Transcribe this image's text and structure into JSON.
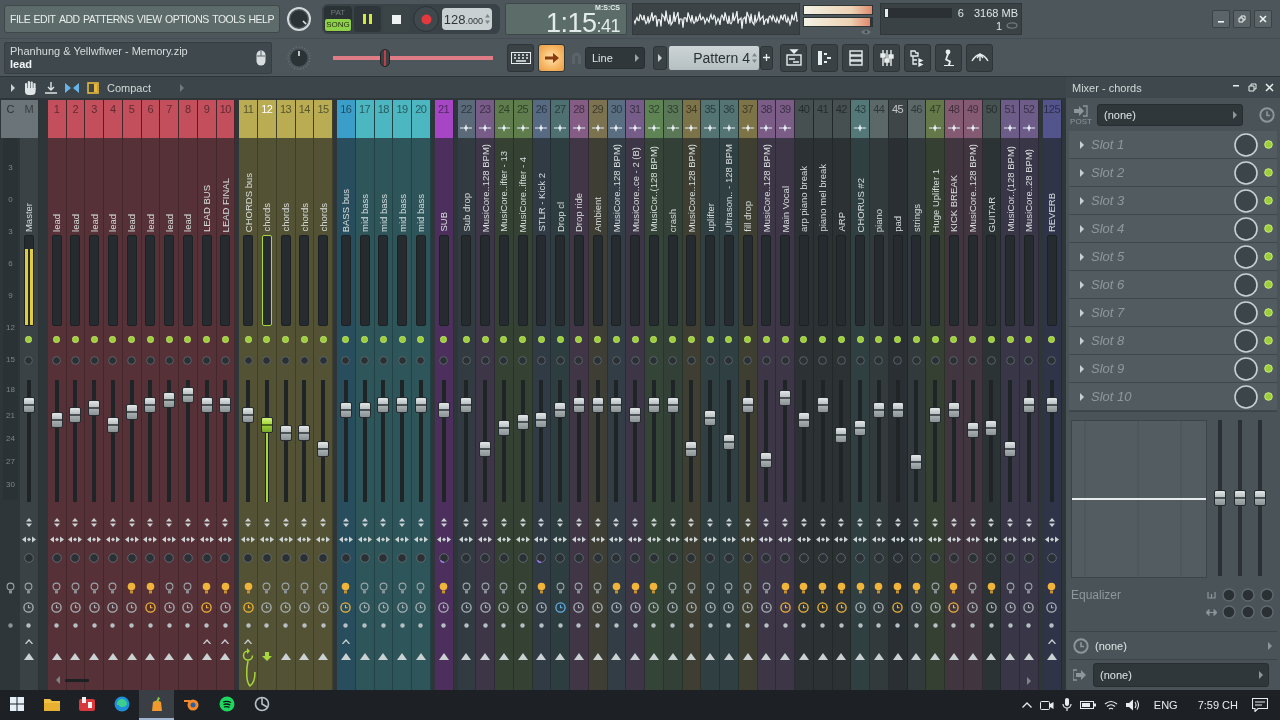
{
  "toolbar": {
    "menu": [
      "FILE",
      "EDIT",
      "ADD",
      "PATTERNS",
      "VIEW",
      "OPTIONS",
      "TOOLS",
      "HELP"
    ],
    "modes": [
      {
        "label": "PAT",
        "selected": false
      },
      {
        "label": "SONG",
        "selected": true
      }
    ],
    "playing": true,
    "tempo": "128",
    "tempo_fraction": ".000",
    "time": "1:15",
    "time_fraction": ":41",
    "time_format": "M:S:CS",
    "output_meter": [
      {
        "level": 1
      },
      {
        "level": 0.97
      }
    ],
    "cpu": {
      "level": 0.04
    },
    "voices": "6",
    "memory": "3168 MB",
    "counter": "1",
    "hint_title": "Phanhung & Yellwflwer - Memory.zip",
    "hint_text": "lead",
    "pitch": {
      "level": 0.31
    },
    "arrow_button": {
      "on": true
    },
    "snap": "Line",
    "pattern": "Pattern 4"
  },
  "mixer_bar": {
    "view": "Compact"
  },
  "mixer": {
    "current_label": "C",
    "scale": [
      "3",
      "0",
      "3",
      "6",
      "9",
      "12",
      "15",
      "18",
      "21",
      "24",
      "27",
      "30"
    ],
    "master": {
      "number": "M",
      "name": "Master",
      "active": true,
      "level": 0.84,
      "meter": {
        "level": 0.85
      },
      "bulb_lit": false,
      "clock_on": false,
      "send_caret": true
    },
    "groups": [
      {
        "strips": [
          {
            "number": "1",
            "name": "lead",
            "color": "#c44f5c",
            "selected": false,
            "active": true,
            "level": 0.7,
            "header_icon": false,
            "stereo_arc": false,
            "bulb_lit": false,
            "clock_on": false,
            "clock_focused": false,
            "send_caret": false,
            "route_target": false
          },
          {
            "number": "2",
            "name": "lead",
            "color": "#c44f5c",
            "selected": false,
            "active": true,
            "level": 0.75,
            "header_icon": false,
            "stereo_arc": false,
            "bulb_lit": false,
            "clock_on": false,
            "clock_focused": false,
            "send_caret": false,
            "route_target": false
          },
          {
            "number": "3",
            "name": "lead",
            "color": "#c44f5c",
            "selected": false,
            "active": true,
            "level": 0.81,
            "header_icon": false,
            "stereo_arc": false,
            "bulb_lit": false,
            "clock_on": false,
            "clock_focused": false,
            "send_caret": false,
            "route_target": false
          },
          {
            "number": "4",
            "name": "lead",
            "color": "#c44f5c",
            "selected": false,
            "active": true,
            "level": 0.65,
            "header_icon": false,
            "stereo_arc": false,
            "bulb_lit": false,
            "clock_on": false,
            "clock_focused": false,
            "send_caret": false,
            "route_target": false
          },
          {
            "number": "5",
            "name": "lead",
            "color": "#c44f5c",
            "selected": false,
            "active": true,
            "level": 0.77,
            "header_icon": false,
            "stereo_arc": false,
            "bulb_lit": true,
            "clock_on": false,
            "clock_focused": false,
            "send_caret": false,
            "route_target": false
          },
          {
            "number": "6",
            "name": "lead",
            "color": "#c44f5c",
            "selected": false,
            "active": true,
            "level": 0.84,
            "header_icon": false,
            "stereo_arc": false,
            "bulb_lit": true,
            "clock_on": true,
            "clock_focused": false,
            "send_caret": false,
            "route_target": false
          },
          {
            "number": "7",
            "name": "lead",
            "color": "#c44f5c",
            "selected": false,
            "active": true,
            "level": 0.89,
            "header_icon": false,
            "stereo_arc": false,
            "bulb_lit": false,
            "clock_on": false,
            "clock_focused": false,
            "send_caret": false,
            "route_target": false
          },
          {
            "number": "8",
            "name": "lead",
            "color": "#c44f5c",
            "selected": false,
            "active": true,
            "level": 0.93,
            "header_icon": false,
            "stereo_arc": false,
            "bulb_lit": false,
            "clock_on": false,
            "clock_focused": false,
            "send_caret": false,
            "route_target": false
          },
          {
            "number": "9",
            "name": "LEAD BUS",
            "color": "#c44f5c",
            "selected": false,
            "active": true,
            "level": 0.84,
            "header_icon": false,
            "stereo_arc": false,
            "bulb_lit": true,
            "clock_on": true,
            "clock_focused": false,
            "send_caret": true,
            "route_target": false
          },
          {
            "number": "10",
            "name": "LEAD FINAL",
            "color": "#c44f5c",
            "selected": false,
            "active": true,
            "level": 0.84,
            "header_icon": false,
            "stereo_arc": false,
            "bulb_lit": true,
            "clock_on": false,
            "clock_focused": false,
            "send_caret": true,
            "route_target": false
          }
        ]
      },
      {
        "strips": [
          {
            "number": "11",
            "name": "CHORDS bus",
            "color": "#b9ac52",
            "selected": false,
            "active": true,
            "level": 0.75,
            "header_icon": false,
            "stereo_arc": false,
            "bulb_lit": true,
            "clock_on": true,
            "clock_focused": false,
            "send_caret": true,
            "route_target": true
          },
          {
            "number": "12",
            "name": "chords",
            "color": "#b9ac52",
            "selected": true,
            "active": true,
            "level": 0.65,
            "header_icon": false,
            "stereo_arc": false,
            "bulb_lit": false,
            "clock_on": false,
            "clock_focused": false,
            "send_caret": false,
            "route_target": false
          },
          {
            "number": "13",
            "name": "chords",
            "color": "#b9ac52",
            "selected": false,
            "active": true,
            "level": 0.58,
            "header_icon": false,
            "stereo_arc": false,
            "bulb_lit": false,
            "clock_on": false,
            "clock_focused": false,
            "send_caret": false,
            "route_target": false
          },
          {
            "number": "14",
            "name": "chords",
            "color": "#b9ac52",
            "selected": false,
            "active": true,
            "level": 0.58,
            "header_icon": false,
            "stereo_arc": false,
            "bulb_lit": false,
            "clock_on": false,
            "clock_focused": false,
            "send_caret": false,
            "route_target": false
          },
          {
            "number": "15",
            "name": "chords",
            "color": "#b9ac52",
            "selected": false,
            "active": true,
            "level": 0.42,
            "header_icon": false,
            "stereo_arc": false,
            "bulb_lit": false,
            "clock_on": false,
            "clock_focused": false,
            "send_caret": false,
            "route_target": false
          }
        ]
      },
      {
        "strips": [
          {
            "number": "16",
            "name": "BASS bus",
            "color": "#3a9ec8",
            "selected": false,
            "active": true,
            "level": 0.79,
            "header_icon": false,
            "stereo_arc": false,
            "bulb_lit": true,
            "clock_on": true,
            "clock_focused": false,
            "send_caret": true,
            "route_target": false
          },
          {
            "number": "17",
            "name": "mid bass",
            "color": "#4cb7c0",
            "selected": false,
            "active": true,
            "level": 0.79,
            "header_icon": false,
            "stereo_arc": false,
            "bulb_lit": false,
            "clock_on": false,
            "clock_focused": false,
            "send_caret": false,
            "route_target": false
          },
          {
            "number": "18",
            "name": "mid bass",
            "color": "#4cb7c0",
            "selected": false,
            "active": true,
            "level": 0.84,
            "header_icon": false,
            "stereo_arc": false,
            "bulb_lit": false,
            "clock_on": false,
            "clock_focused": false,
            "send_caret": false,
            "route_target": false
          },
          {
            "number": "19",
            "name": "mid bass",
            "color": "#4cb7c0",
            "selected": false,
            "active": true,
            "level": 0.84,
            "header_icon": false,
            "stereo_arc": false,
            "bulb_lit": false,
            "clock_on": false,
            "clock_focused": false,
            "send_caret": false,
            "route_target": false
          },
          {
            "number": "20",
            "name": "mid bass",
            "color": "#4cb7c0",
            "selected": false,
            "active": true,
            "level": 0.84,
            "header_icon": false,
            "stereo_arc": false,
            "bulb_lit": false,
            "clock_on": false,
            "clock_focused": false,
            "send_caret": false,
            "route_target": false
          }
        ]
      },
      {
        "strips": [
          {
            "number": "21",
            "name": "SUB",
            "color": "#a646c4",
            "selected": false,
            "active": true,
            "level": 0.79,
            "header_icon": false,
            "stereo_arc": true,
            "bulb_lit": true,
            "clock_on": false,
            "clock_focused": false,
            "send_caret": false,
            "route_target": false
          }
        ]
      },
      {
        "strips": [
          {
            "number": "22",
            "name": "Sub drop",
            "color": "#5a6a78",
            "selected": false,
            "active": true,
            "level": 0.84,
            "header_icon": true,
            "stereo_arc": false,
            "bulb_lit": false,
            "clock_on": false,
            "clock_focused": false,
            "send_caret": false,
            "route_target": false
          },
          {
            "number": "23",
            "name": "MusiCore..128 BPM)",
            "color": "#785c88",
            "selected": false,
            "active": true,
            "level": 0.42,
            "header_icon": true,
            "stereo_arc": false,
            "bulb_lit": false,
            "clock_on": false,
            "clock_focused": false,
            "send_caret": false,
            "route_target": false
          },
          {
            "number": "24",
            "name": "MusiCore..ifter - 13",
            "color": "#5e7c4c",
            "selected": false,
            "active": true,
            "level": 0.62,
            "header_icon": true,
            "stereo_arc": false,
            "bulb_lit": false,
            "clock_on": false,
            "clock_focused": false,
            "send_caret": false,
            "route_target": false
          },
          {
            "number": "25",
            "name": "MusiCore..ifter - 4",
            "color": "#5e7c4c",
            "selected": false,
            "active": true,
            "level": 0.68,
            "header_icon": true,
            "stereo_arc": false,
            "bulb_lit": false,
            "clock_on": false,
            "clock_focused": false,
            "send_caret": false,
            "route_target": false
          },
          {
            "number": "26",
            "name": "STLR - Kick 2",
            "color": "#566a82",
            "selected": false,
            "active": true,
            "level": 0.7,
            "header_icon": true,
            "stereo_arc": true,
            "bulb_lit": true,
            "clock_on": false,
            "clock_focused": false,
            "send_caret": false,
            "route_target": false
          },
          {
            "number": "27",
            "name": "Drop cl",
            "color": "#4e7070",
            "selected": false,
            "active": true,
            "level": 0.79,
            "header_icon": true,
            "stereo_arc": false,
            "bulb_lit": false,
            "clock_on": false,
            "clock_focused": true,
            "send_caret": false,
            "route_target": false
          },
          {
            "number": "28",
            "name": "Drop ride",
            "color": "#845c84",
            "selected": false,
            "active": true,
            "level": 0.84,
            "header_icon": true,
            "stereo_arc": false,
            "bulb_lit": false,
            "clock_on": false,
            "clock_focused": false,
            "send_caret": false,
            "route_target": false
          },
          {
            "number": "29",
            "name": "Ambient",
            "color": "#7c7250",
            "selected": false,
            "active": true,
            "level": 0.84,
            "header_icon": true,
            "stereo_arc": false,
            "bulb_lit": false,
            "clock_on": false,
            "clock_focused": false,
            "send_caret": false,
            "route_target": false
          },
          {
            "number": "30",
            "name": "MusiCore..128 BPM)",
            "color": "#5a6e82",
            "selected": false,
            "active": true,
            "level": 0.84,
            "header_icon": true,
            "stereo_arc": false,
            "bulb_lit": true,
            "clock_on": false,
            "clock_focused": false,
            "send_caret": false,
            "route_target": false
          },
          {
            "number": "31",
            "name": "MusiCore..ce - 2 (B)",
            "color": "#765c88",
            "selected": false,
            "active": true,
            "level": 0.75,
            "header_icon": true,
            "stereo_arc": false,
            "bulb_lit": true,
            "clock_on": false,
            "clock_focused": false,
            "send_caret": false,
            "route_target": false
          },
          {
            "number": "32",
            "name": "MusiCor..(128 BPM)",
            "color": "#5e8454",
            "selected": false,
            "active": true,
            "level": 0.84,
            "header_icon": true,
            "stereo_arc": false,
            "bulb_lit": true,
            "clock_on": false,
            "clock_focused": false,
            "send_caret": false,
            "route_target": false
          },
          {
            "number": "33",
            "name": "crash",
            "color": "#5a7858",
            "selected": false,
            "active": true,
            "level": 0.84,
            "header_icon": true,
            "stereo_arc": false,
            "bulb_lit": false,
            "clock_on": false,
            "clock_focused": false,
            "send_caret": false,
            "route_target": false
          },
          {
            "number": "34",
            "name": "MusiCore..128 BPM)",
            "color": "#7c7448",
            "selected": false,
            "active": true,
            "level": 0.42,
            "header_icon": true,
            "stereo_arc": false,
            "bulb_lit": false,
            "clock_on": false,
            "clock_focused": false,
            "send_caret": false,
            "route_target": false
          },
          {
            "number": "35",
            "name": "uplifter",
            "color": "#547474",
            "selected": false,
            "active": true,
            "level": 0.72,
            "header_icon": true,
            "stereo_arc": false,
            "bulb_lit": false,
            "clock_on": false,
            "clock_focused": false,
            "send_caret": false,
            "route_target": false
          },
          {
            "number": "36",
            "name": "Ultrason.. - 128 BPM",
            "color": "#547474",
            "selected": false,
            "active": true,
            "level": 0.49,
            "header_icon": true,
            "stereo_arc": false,
            "bulb_lit": false,
            "clock_on": false,
            "clock_focused": false,
            "send_caret": false,
            "route_target": false
          },
          {
            "number": "37",
            "name": "fill drop",
            "color": "#7c7446",
            "selected": false,
            "active": true,
            "level": 0.84,
            "header_icon": true,
            "stereo_arc": false,
            "bulb_lit": false,
            "clock_on": false,
            "clock_focused": false,
            "send_caret": false,
            "route_target": false
          },
          {
            "number": "38",
            "name": "MusiCore..128 BPM)",
            "color": "#7a5c86",
            "selected": false,
            "active": true,
            "level": 0.32,
            "header_icon": true,
            "stereo_arc": false,
            "bulb_lit": false,
            "clock_on": false,
            "clock_focused": false,
            "send_caret": false,
            "route_target": false
          },
          {
            "number": "39",
            "name": "Main Vocal",
            "color": "#7a5c86",
            "selected": false,
            "active": true,
            "level": 0.91,
            "header_icon": true,
            "stereo_arc": false,
            "bulb_lit": true,
            "clock_on": true,
            "clock_focused": false,
            "send_caret": false,
            "route_target": false
          },
          {
            "number": "40",
            "name": "arp piano break",
            "color": "#465050",
            "selected": false,
            "active": true,
            "level": 0.7,
            "header_icon": false,
            "stereo_arc": false,
            "bulb_lit": true,
            "clock_on": true,
            "clock_focused": false,
            "send_caret": false,
            "route_target": false
          },
          {
            "number": "41",
            "name": "piano mel break",
            "color": "#465050",
            "selected": false,
            "active": true,
            "level": 0.84,
            "header_icon": false,
            "stereo_arc": false,
            "bulb_lit": true,
            "clock_on": true,
            "clock_focused": false,
            "send_caret": false,
            "route_target": false
          },
          {
            "number": "42",
            "name": "ARP",
            "color": "#465050",
            "selected": false,
            "active": true,
            "level": 0.56,
            "header_icon": false,
            "stereo_arc": false,
            "bulb_lit": true,
            "clock_on": true,
            "clock_focused": false,
            "send_caret": false,
            "route_target": false
          },
          {
            "number": "43",
            "name": "CHORUS #2",
            "color": "#547878",
            "selected": false,
            "active": true,
            "level": 0.62,
            "header_icon": true,
            "stereo_arc": false,
            "bulb_lit": true,
            "clock_on": false,
            "clock_focused": false,
            "send_caret": false,
            "route_target": false
          },
          {
            "number": "44",
            "name": "piano",
            "color": "#5c6868",
            "selected": false,
            "active": true,
            "level": 0.79,
            "header_icon": false,
            "stereo_arc": false,
            "bulb_lit": true,
            "clock_on": false,
            "clock_focused": false,
            "send_caret": false,
            "route_target": false
          },
          {
            "number": "45",
            "name": "pad",
            "color": "#3e4648",
            "selected": false,
            "active": true,
            "level": 0.79,
            "header_icon": false,
            "stereo_arc": false,
            "bulb_lit": true,
            "clock_on": true,
            "clock_focused": false,
            "send_caret": false,
            "route_target": false
          },
          {
            "number": "46",
            "name": "strings",
            "color": "#5c6868",
            "selected": false,
            "active": true,
            "level": 0.3,
            "header_icon": false,
            "stereo_arc": false,
            "bulb_lit": true,
            "clock_on": false,
            "clock_focused": false,
            "send_caret": false,
            "route_target": false
          },
          {
            "number": "47",
            "name": "Huge Uplifter 1",
            "color": "#64784a",
            "selected": false,
            "active": true,
            "level": 0.75,
            "header_icon": true,
            "stereo_arc": false,
            "bulb_lit": false,
            "clock_on": false,
            "clock_focused": false,
            "send_caret": false,
            "route_target": false
          },
          {
            "number": "48",
            "name": "KICK BREAK",
            "color": "#845a72",
            "selected": false,
            "active": true,
            "level": 0.79,
            "header_icon": true,
            "stereo_arc": false,
            "bulb_lit": true,
            "clock_on": true,
            "clock_focused": false,
            "send_caret": false,
            "route_target": false
          },
          {
            "number": "49",
            "name": "MusiCore..128 BPM)",
            "color": "#845a72",
            "selected": false,
            "active": true,
            "level": 0.6,
            "header_icon": true,
            "stereo_arc": false,
            "bulb_lit": false,
            "clock_on": false,
            "clock_focused": false,
            "send_caret": false,
            "route_target": false
          },
          {
            "number": "50",
            "name": "GUITAR",
            "color": "#465252",
            "selected": false,
            "active": true,
            "level": 0.62,
            "header_icon": false,
            "stereo_arc": false,
            "bulb_lit": true,
            "clock_on": false,
            "clock_focused": false,
            "send_caret": false,
            "route_target": false
          },
          {
            "number": "51",
            "name": "MusiCor..(128 BPM)",
            "color": "#6e5c88",
            "selected": false,
            "active": true,
            "level": 0.42,
            "header_icon": true,
            "stereo_arc": false,
            "bulb_lit": false,
            "clock_on": false,
            "clock_focused": false,
            "send_caret": false,
            "route_target": false
          },
          {
            "number": "52",
            "name": "MusiCore..28 BPM)",
            "color": "#6e5c88",
            "selected": false,
            "active": true,
            "level": 0.84,
            "header_icon": true,
            "stereo_arc": false,
            "bulb_lit": false,
            "clock_on": false,
            "clock_focused": false,
            "send_caret": false,
            "route_target": false
          }
        ]
      },
      {
        "strips": [
          {
            "number": "125",
            "name": "REVERB",
            "color": "#54548c",
            "selected": false,
            "active": true,
            "level": 0.84,
            "header_icon": false,
            "stereo_arc": false,
            "bulb_lit": true,
            "clock_on": false,
            "clock_focused": false,
            "send_caret": true,
            "route_target": false
          }
        ]
      }
    ]
  },
  "inspector": {
    "title": "Mixer - chords",
    "post_label": "POST",
    "input": "(none)",
    "slots": [
      {
        "label": "Slot 1",
        "enabled": true
      },
      {
        "label": "Slot 2",
        "enabled": true
      },
      {
        "label": "Slot 3",
        "enabled": true
      },
      {
        "label": "Slot 4",
        "enabled": true
      },
      {
        "label": "Slot 5",
        "enabled": true
      },
      {
        "label": "Slot 6",
        "enabled": true
      },
      {
        "label": "Slot 7",
        "enabled": true
      },
      {
        "label": "Slot 8",
        "enabled": true
      },
      {
        "label": "Slot 9",
        "enabled": true
      },
      {
        "label": "Slot 10",
        "enabled": true
      }
    ],
    "eq": {
      "label": "Equalizer",
      "bands": [
        {
          "level": 0.5
        },
        {
          "level": 0.5
        },
        {
          "level": 0.5
        }
      ]
    },
    "latency": "(none)",
    "output": "(none)"
  },
  "taskbar": {
    "language": "ENG",
    "clock": "7:59 CH"
  }
}
